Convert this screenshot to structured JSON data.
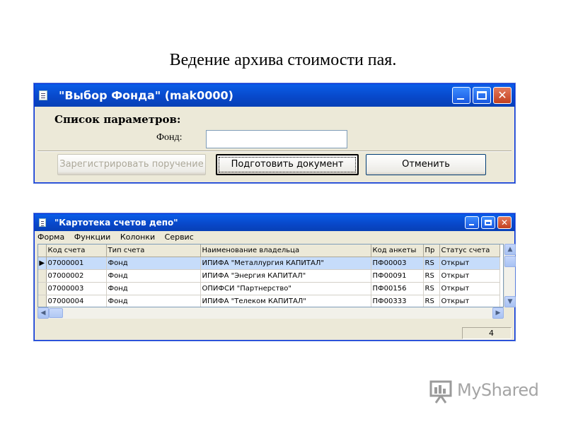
{
  "slide": {
    "title": "Ведение архива стоимости пая."
  },
  "window1": {
    "title": "\"Выбор Фонда\" (mak0000)",
    "params_label": "Список параметров:",
    "fund_label": "Фонд:",
    "fund_value": "",
    "buttons": {
      "register": "Зарегистрировать поручение",
      "prepare": "Подготовить документ",
      "cancel": "Отменить"
    },
    "register_enabled": false
  },
  "window2": {
    "title": "\"Картотека счетов депо\"",
    "menu": [
      "Форма",
      "Функции",
      "Колонки",
      "Сервис"
    ],
    "columns": [
      "Код счета",
      "Тип счета",
      "Наименование владельца",
      "Код анкеты",
      "Пр",
      "Статус счета"
    ],
    "rows": [
      [
        "07000001",
        "Фонд",
        "ИПИФА \"Металлургия КАПИТАЛ\"",
        "ПФ00003",
        "RS",
        "Открыт"
      ],
      [
        "07000002",
        "Фонд",
        "ИПИФА \"Энергия КАПИТАЛ\"",
        "ПФ00091",
        "RS",
        "Открыт"
      ],
      [
        "07000003",
        "Фонд",
        "ОПИФСИ \"Партнерство\"",
        "ПФ00156",
        "RS",
        "Открыт"
      ],
      [
        "07000004",
        "Фонд",
        "ИПИФА \"Телеком КАПИТАЛ\"",
        "ПФ00333",
        "RS",
        "Открыт"
      ]
    ],
    "selected_row": 0,
    "status_count": "4"
  },
  "logo": {
    "text": "MyShared"
  },
  "colors": {
    "titlebar": "#0847c8",
    "selection": "#c6dcfa",
    "window_bg": "#ece9d8"
  }
}
